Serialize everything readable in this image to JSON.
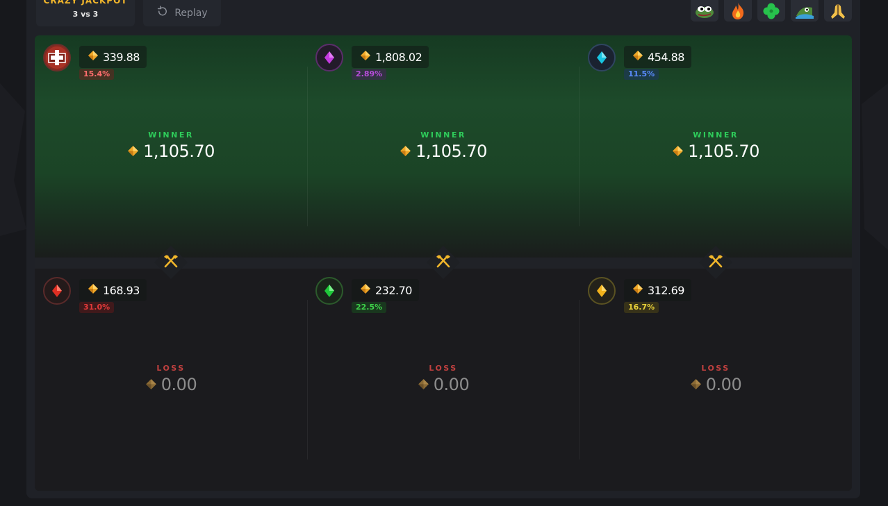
{
  "game": {
    "mode_title": "CRAZY JACKPOT",
    "mode_sub": "3 vs 3",
    "replay_label": "Replay"
  },
  "emotes": [
    {
      "name": "pepe-emote"
    },
    {
      "name": "fire-emote"
    },
    {
      "name": "clover-emote"
    },
    {
      "name": "pepe-wave-emote"
    },
    {
      "name": "pray-emote"
    }
  ],
  "colors": {
    "win_green": "#2ecc5a",
    "loss_red": "#c0403f",
    "gem_gold": "#f0a828",
    "accent_yellow": "#f1b62b"
  },
  "winners": [
    {
      "balance": "339.88",
      "pct": "15.4%",
      "pct_color": "#ff6d6d",
      "avatar": "medic-avatar",
      "result_label": "WINNER",
      "result_amount": "1,105.70"
    },
    {
      "balance": "1,808.02",
      "pct": "2.89%",
      "pct_color": "#b84ddb",
      "avatar": "purple-gem-avatar",
      "result_label": "WINNER",
      "result_amount": "1,105.70"
    },
    {
      "balance": "454.88",
      "pct": "11.5%",
      "pct_color": "#5a8cff",
      "avatar": "cyan-gem-avatar",
      "result_label": "WINNER",
      "result_amount": "1,105.70"
    }
  ],
  "losers": [
    {
      "balance": "168.93",
      "pct": "31.0%",
      "pct_color": "#e23a3a",
      "avatar": "red-gem-avatar",
      "result_label": "LOSS",
      "result_amount": "0.00"
    },
    {
      "balance": "232.70",
      "pct": "22.5%",
      "pct_color": "#3fd04a",
      "avatar": "green-gem-avatar",
      "result_label": "LOSS",
      "result_amount": "0.00"
    },
    {
      "balance": "312.69",
      "pct": "16.7%",
      "pct_color": "#e8d03a",
      "avatar": "yellow-gem-avatar",
      "result_label": "LOSS",
      "result_amount": "0.00"
    }
  ]
}
